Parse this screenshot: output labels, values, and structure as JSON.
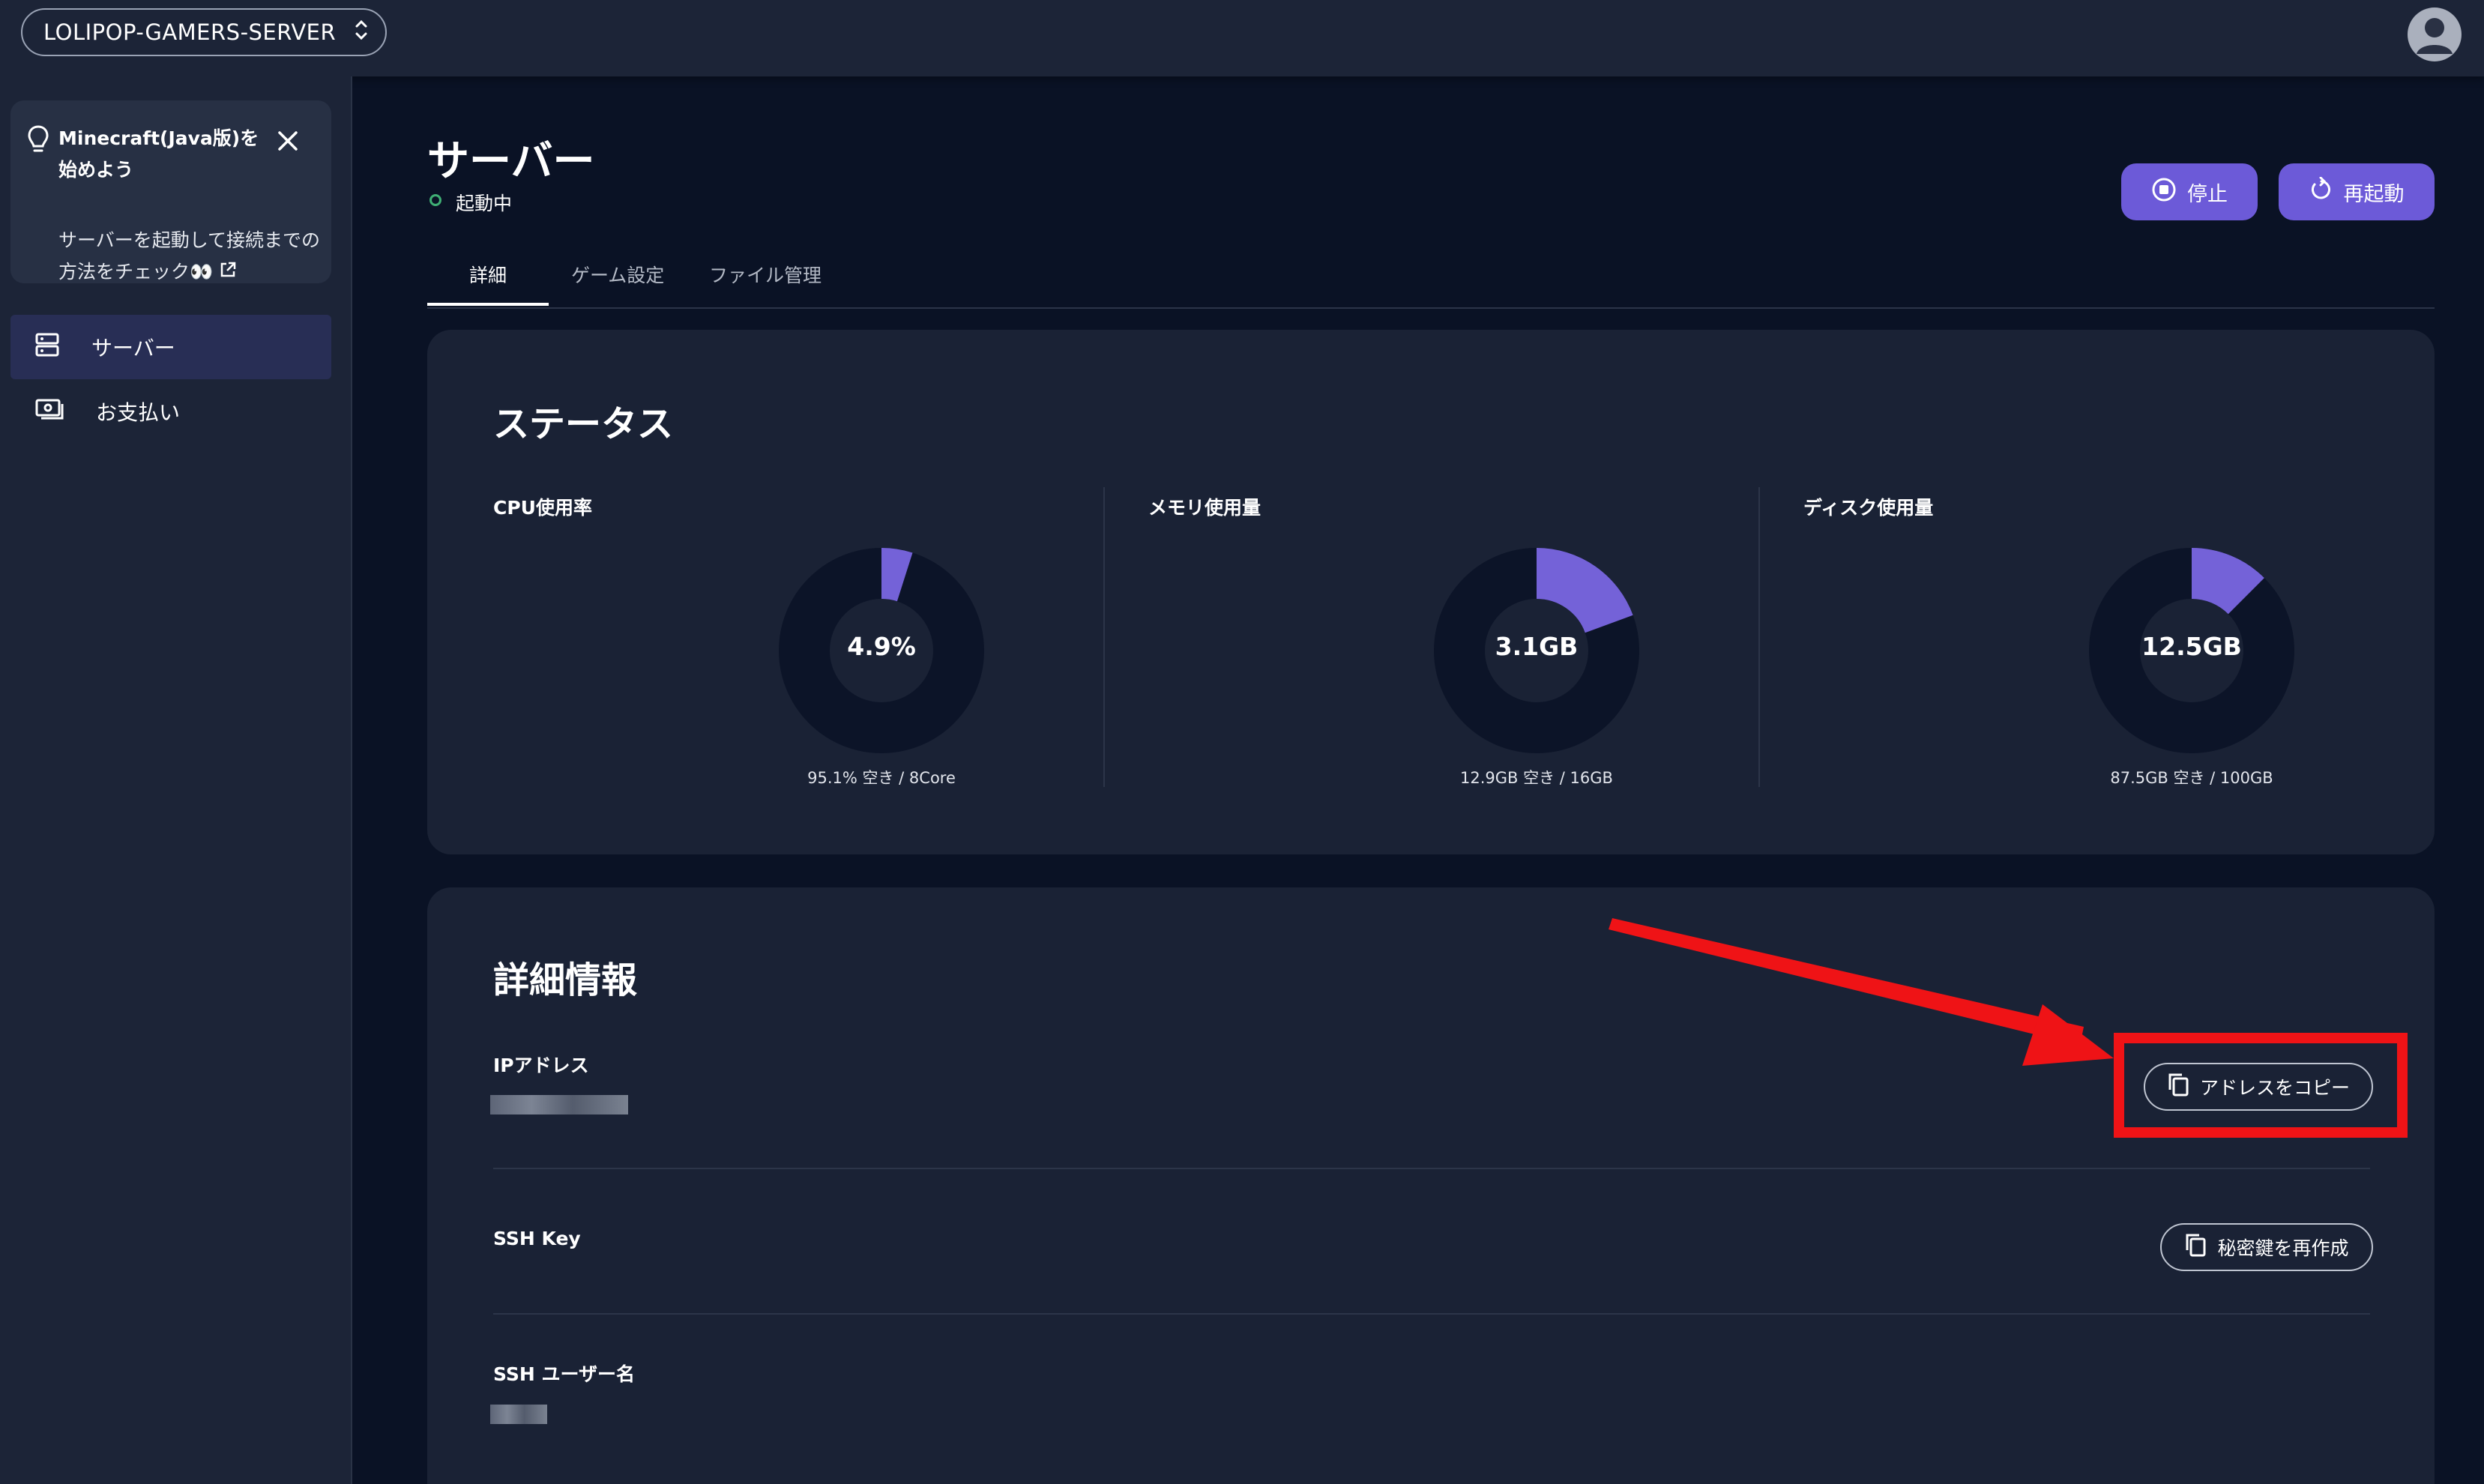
{
  "topbar": {
    "server_name": "LOLIPOP-GAMERS-SERVER"
  },
  "sidebar": {
    "tip": {
      "title": "Minecraft(Java版)を始めよう",
      "body": "サーバーを起動して接続までの方法をチェック👀"
    },
    "items": [
      {
        "label": "サーバー",
        "icon": "server-icon",
        "active": true
      },
      {
        "label": "お支払い",
        "icon": "payment-icon",
        "active": false
      }
    ]
  },
  "main": {
    "title": "サーバー",
    "status": "起動中",
    "actions": {
      "stop": "停止",
      "restart": "再起動"
    },
    "tabs": [
      {
        "label": "詳細",
        "active": true
      },
      {
        "label": "ゲーム設定",
        "active": false
      },
      {
        "label": "ファイル管理",
        "active": false
      }
    ],
    "status_card": {
      "title": "ステータス",
      "metrics": [
        {
          "label": "CPU使用率",
          "value": "4.9%",
          "sub": "95.1% 空き / 8Core",
          "fraction": 0.049
        },
        {
          "label": "メモリ使用量",
          "value": "3.1GB",
          "sub": "12.9GB 空き / 16GB",
          "fraction": 0.194
        },
        {
          "label": "ディスク使用量",
          "value": "12.5GB",
          "sub": "87.5GB 空き / 100GB",
          "fraction": 0.125
        }
      ]
    },
    "details_card": {
      "title": "詳細情報",
      "ip_label": "IPアドレス",
      "copy_address": "アドレスをコピー",
      "ssh_key_label": "SSH Key",
      "regenerate_key": "秘密鍵を再作成",
      "ssh_user_label": "SSH ユーザー名"
    }
  },
  "colors": {
    "accent": "#6c5ad8",
    "donut_fill": "#7462d8",
    "donut_track": "#0c1428",
    "status_ok": "#3fae74",
    "highlight": "#ef1316"
  }
}
